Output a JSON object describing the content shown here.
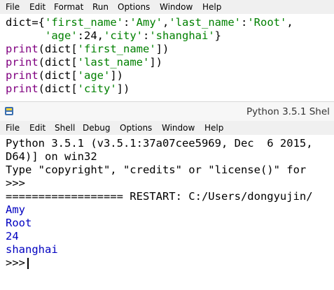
{
  "editor_menu": [
    "File",
    "Edit",
    "Format",
    "Run",
    "Options",
    "Window",
    "Help"
  ],
  "editor_code": {
    "line1": {
      "a": "dict={",
      "b": "'first_name'",
      "c": ":",
      "d": "'Amy'",
      "e": ",",
      "f": "'last_name'",
      "g": ":",
      "h": "'Root'",
      "i": ","
    },
    "line2": {
      "a": "      ",
      "b": "'age'",
      "c": ":24,",
      "d": "'city'",
      "e": ":",
      "f": "'shanghai'",
      "g": "}"
    },
    "line3": {
      "a": "print",
      "b": "(dict[",
      "c": "'first_name'",
      "d": "])"
    },
    "line4": {
      "a": "print",
      "b": "(dict[",
      "c": "'last_name'",
      "d": "])"
    },
    "line5": {
      "a": "print",
      "b": "(dict[",
      "c": "'age'",
      "d": "])"
    },
    "line6": {
      "a": "print",
      "b": "(dict[",
      "c": "'city'",
      "d": "])"
    }
  },
  "shell_window": {
    "title": "Python 3.5.1 Shel",
    "menu": [
      "File",
      "Edit",
      "Shell",
      "Debug",
      "Options",
      "Window",
      "Help"
    ]
  },
  "shell_text": {
    "banner1": "Python 3.5.1 (v3.5.1:37a07cee5969, Dec  6 2015,",
    "banner2": "D64)] on win32",
    "banner3": "Type \"copyright\", \"credits\" or \"license()\" for",
    "prompt1": ">>>",
    "restart": "================== RESTART: C:/Users/dongyujin/",
    "out1": "Amy",
    "out2": "Root",
    "out3": "24",
    "out4": "shanghai",
    "prompt2": ">>>"
  }
}
